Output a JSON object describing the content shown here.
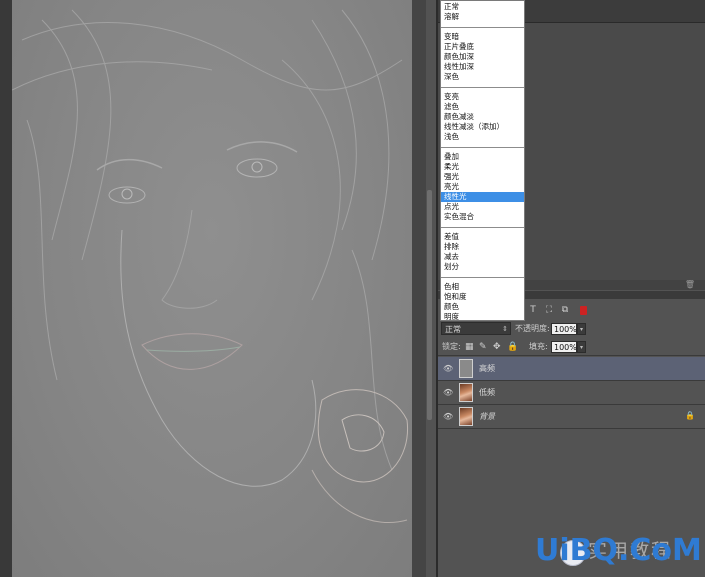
{
  "blend_menu": {
    "groups": [
      [
        "正常",
        "溶解"
      ],
      [
        "变暗",
        "正片叠底",
        "颜色加深",
        "线性加深",
        "深色"
      ],
      [
        "变亮",
        "滤色",
        "颜色减淡",
        "线性减淡（添加）",
        "浅色"
      ],
      [
        "叠加",
        "柔光",
        "强光",
        "亮光",
        "线性光",
        "点光",
        "实色混合"
      ],
      [
        "差值",
        "排除",
        "减去",
        "划分"
      ],
      [
        "色相",
        "饱和度",
        "颜色",
        "明度"
      ]
    ],
    "selected": "线性光"
  },
  "layers_panel": {
    "blend_mode": "正常",
    "opacity_label": "不透明度:",
    "opacity_value": "100%",
    "lock_label": "锁定:",
    "fill_label": "填充:",
    "fill_value": "100%",
    "layers": [
      {
        "name": "高频",
        "thumb": "gray",
        "visible": true,
        "selected": true,
        "locked": false
      },
      {
        "name": "低频",
        "thumb": "photo",
        "visible": true,
        "selected": false,
        "locked": false
      },
      {
        "name": "背景",
        "thumb": "photo",
        "visible": true,
        "selected": false,
        "locked": true,
        "italic": true
      }
    ]
  },
  "icons": {
    "eye": "eye-icon",
    "lock": "lock-icon",
    "trash": "trash-icon",
    "filter_type": "type-filter-icon",
    "filter_shape": "shape-filter-icon",
    "filter_smart": "smart-object-filter-icon",
    "filter_toggle": "filter-toggle-icon",
    "brush": "brush-icon",
    "move": "move-icon",
    "checker": "lock-transparent-icon"
  },
  "colors": {
    "menu_highlight": "#3d8fe6",
    "selected_layer": "#5c6275",
    "panel_bg": "#535353",
    "watermark_blue": "#2f7bd3"
  },
  "watermark": {
    "text_cn": "实用教程",
    "text_brand": "UiBQ.CoM"
  }
}
